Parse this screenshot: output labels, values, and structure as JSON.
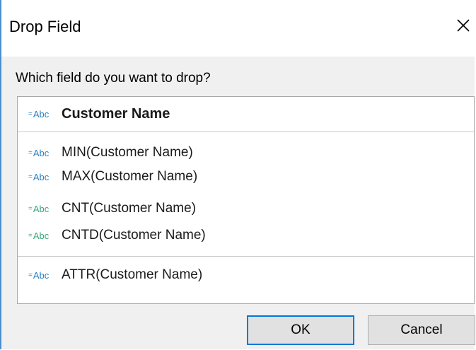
{
  "dialog": {
    "title": "Drop Field",
    "prompt": "Which field do you want to drop?",
    "close_icon": "close-x-icon"
  },
  "fields": [
    {
      "label": "Customer Name",
      "type_badge": "Abc",
      "type_prefix": "=",
      "badge_color": "#2a7fbf",
      "primary": true
    },
    {
      "label": "MIN(Customer Name)",
      "type_badge": "Abc",
      "type_prefix": "=",
      "badge_color": "#2a7fbf",
      "primary": false
    },
    {
      "label": "MAX(Customer Name)",
      "type_badge": "Abc",
      "type_prefix": "=",
      "badge_color": "#2a7fbf",
      "primary": false
    },
    {
      "label": "CNT(Customer Name)",
      "type_badge": "Abc",
      "type_prefix": "=",
      "badge_color": "#3aa57a",
      "primary": false
    },
    {
      "label": "CNTD(Customer Name)",
      "type_badge": "Abc",
      "type_prefix": "=",
      "badge_color": "#3aa57a",
      "primary": false
    },
    {
      "label": "ATTR(Customer Name)",
      "type_badge": "Abc",
      "type_prefix": "=",
      "badge_color": "#2a7fbf",
      "primary": false
    }
  ],
  "buttons": {
    "ok": "OK",
    "cancel": "Cancel"
  },
  "colors": {
    "accent": "#0078d7",
    "window_border": "#4a8fd0"
  }
}
